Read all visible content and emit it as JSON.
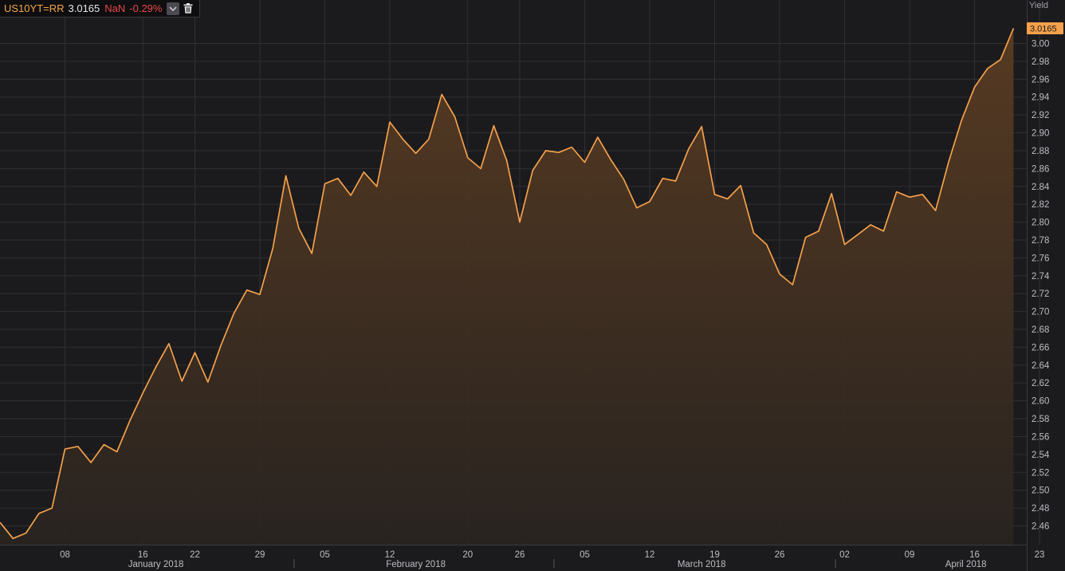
{
  "legend": {
    "ric": "US10YT=RR",
    "last": "3.0165",
    "change": "NaN",
    "change_pct": "-0.29%",
    "dropdown_icon": "chevron-down-icon",
    "delete_icon": "trash-icon"
  },
  "colors": {
    "line": "#f5a04a",
    "area_top": "#5a3c22",
    "area_bottom": "#2a2420",
    "grid": "#303034",
    "background": "#1b1b1e",
    "last_tag": "#f5a04a",
    "negative": "#e84a4a"
  },
  "chart_data": {
    "type": "area",
    "ylabel": "Yield",
    "last_value_label": "3.0165",
    "ylim": [
      2.44,
      3.02
    ],
    "yticks": [
      "2.46",
      "2.48",
      "2.50",
      "2.52",
      "2.54",
      "2.56",
      "2.58",
      "2.60",
      "2.62",
      "2.64",
      "2.66",
      "2.68",
      "2.70",
      "2.72",
      "2.74",
      "2.76",
      "2.78",
      "2.80",
      "2.82",
      "2.84",
      "2.86",
      "2.88",
      "2.90",
      "2.92",
      "2.94",
      "2.96",
      "2.98",
      "3.00"
    ],
    "xticks": [
      {
        "label": "08",
        "date": "2018-01-08"
      },
      {
        "label": "16",
        "date": "2018-01-16"
      },
      {
        "label": "22",
        "date": "2018-01-22"
      },
      {
        "label": "29",
        "date": "2018-01-29"
      },
      {
        "label": "05",
        "date": "2018-02-05"
      },
      {
        "label": "12",
        "date": "2018-02-12"
      },
      {
        "label": "20",
        "date": "2018-02-20"
      },
      {
        "label": "26",
        "date": "2018-02-26"
      },
      {
        "label": "05",
        "date": "2018-03-05"
      },
      {
        "label": "12",
        "date": "2018-03-12"
      },
      {
        "label": "19",
        "date": "2018-03-19"
      },
      {
        "label": "26",
        "date": "2018-03-26"
      },
      {
        "label": "02",
        "date": "2018-04-02"
      },
      {
        "label": "09",
        "date": "2018-04-09"
      },
      {
        "label": "16",
        "date": "2018-04-16"
      },
      {
        "label": "23",
        "date": "2018-04-23"
      }
    ],
    "months": [
      {
        "label": "January 2018",
        "date": "2018-01-17"
      },
      {
        "label": "February 2018",
        "date": "2018-02-14"
      },
      {
        "label": "March 2018",
        "date": "2018-03-16"
      },
      {
        "label": "April 2018",
        "date": "2018-04-14"
      }
    ],
    "month_separators": [
      "2018-02-01",
      "2018-03-01",
      "2018-04-01"
    ],
    "series": [
      {
        "dates": [
          "2018-01-01",
          "2018-01-02",
          "2018-01-03",
          "2018-01-04",
          "2018-01-05",
          "2018-01-08",
          "2018-01-09",
          "2018-01-10",
          "2018-01-11",
          "2018-01-12",
          "2018-01-15",
          "2018-01-16",
          "2018-01-17",
          "2018-01-18",
          "2018-01-19",
          "2018-01-22",
          "2018-01-23",
          "2018-01-24",
          "2018-01-25",
          "2018-01-26",
          "2018-01-29",
          "2018-01-30",
          "2018-01-31",
          "2018-02-01",
          "2018-02-02",
          "2018-02-05",
          "2018-02-06",
          "2018-02-07",
          "2018-02-08",
          "2018-02-09",
          "2018-02-12",
          "2018-02-13",
          "2018-02-14",
          "2018-02-15",
          "2018-02-16",
          "2018-02-19",
          "2018-02-20",
          "2018-02-21",
          "2018-02-22",
          "2018-02-23",
          "2018-02-26",
          "2018-02-27",
          "2018-02-28",
          "2018-03-01",
          "2018-03-02",
          "2018-03-05",
          "2018-03-06",
          "2018-03-07",
          "2018-03-08",
          "2018-03-09",
          "2018-03-12",
          "2018-03-13",
          "2018-03-14",
          "2018-03-15",
          "2018-03-16",
          "2018-03-19",
          "2018-03-20",
          "2018-03-21",
          "2018-03-22",
          "2018-03-23",
          "2018-03-26",
          "2018-03-27",
          "2018-03-28",
          "2018-03-29",
          "2018-03-30",
          "2018-04-02",
          "2018-04-03",
          "2018-04-04",
          "2018-04-05",
          "2018-04-06",
          "2018-04-09",
          "2018-04-10",
          "2018-04-11",
          "2018-04-12",
          "2018-04-13",
          "2018-04-16",
          "2018-04-17",
          "2018-04-18",
          "2018-04-19",
          "2018-04-20",
          "2018-04-23",
          "2018-04-24"
        ],
        "values": [
          2.464,
          2.446,
          2.452,
          2.474,
          2.48,
          2.546,
          2.549,
          2.531,
          2.551,
          2.543,
          2.578,
          2.609,
          2.638,
          2.664,
          2.622,
          2.654,
          2.621,
          2.662,
          2.698,
          2.724,
          2.719,
          2.771,
          2.852,
          2.793,
          2.765,
          2.843,
          2.849,
          2.83,
          2.856,
          2.84,
          2.912,
          2.893,
          2.877,
          2.893,
          2.943,
          2.918,
          2.872,
          2.86,
          2.908,
          2.869,
          2.8,
          2.858,
          2.88,
          2.878,
          2.884,
          2.867,
          2.895,
          2.87,
          2.848,
          2.816,
          2.823,
          2.849,
          2.846,
          2.882,
          2.907,
          2.831,
          2.826,
          2.841,
          2.788,
          2.775,
          2.742,
          2.73,
          2.783,
          2.79,
          2.832,
          2.775,
          2.786,
          2.797,
          2.79,
          2.834,
          2.828,
          2.831,
          2.813,
          2.867,
          2.914,
          2.951,
          2.972,
          2.982,
          3.017
        ]
      }
    ]
  }
}
